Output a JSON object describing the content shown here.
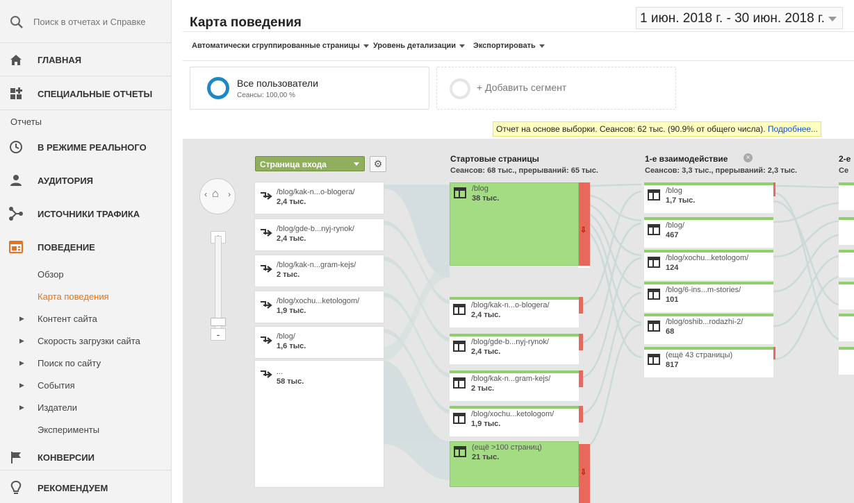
{
  "search": {
    "placeholder": "Поиск в отчетах и Справке"
  },
  "nav": {
    "home": "ГЛАВНАЯ",
    "custom": "СПЕЦИАЛЬНЫЕ ОТЧЕТЫ",
    "reports_section": "Отчеты",
    "realtime": "В РЕЖИМЕ РЕАЛЬНОГО",
    "audience": "АУДИТОРИЯ",
    "acquisition": "ИСТОЧНИКИ ТРАФИКА",
    "behavior": "ПОВЕДЕНИЕ",
    "behavior_items": [
      "Обзор",
      "Карта поведения",
      "Контент сайта",
      "Скорость загрузки сайта",
      "Поиск по сайту",
      "События",
      "Издатели",
      "Эксперименты"
    ],
    "conversions": "КОНВЕРСИИ",
    "recommend": "РЕКОМЕНДУЕМ"
  },
  "header": {
    "title": "Карта поведения",
    "date_range": "1 июн. 2018 г. - 30 июн. 2018 г."
  },
  "toolbar": {
    "grouped": "Автоматически сгруппированные страницы",
    "detail": "Уровень детализации",
    "export": "Экспортировать"
  },
  "segments": {
    "all_users": "Все пользователи",
    "all_users_sub": "Сеансы: 100,00 %",
    "add": "+ Добавить сегмент"
  },
  "notice": {
    "text": "Отчет на основе выборки. Сеансов: 62 тыс. (90.9% от общего числа).",
    "link": "Подробнее..."
  },
  "flow": {
    "dimension": "Страница входа",
    "sources": [
      {
        "name": "/blog/kak-n...o-blogera/",
        "value": "2,4 тыс."
      },
      {
        "name": "/blog/gde-b...nyj-rynok/",
        "value": "2,4 тыс."
      },
      {
        "name": "/blog/kak-n...gram-kejs/",
        "value": "2 тыс."
      },
      {
        "name": "/blog/xochu...ketologom/",
        "value": "1,9 тыс."
      },
      {
        "name": "/blog/",
        "value": "1,6 тыс."
      },
      {
        "name": "...",
        "value": "58 тыс."
      }
    ],
    "start": {
      "title": "Стартовые страницы",
      "sub": "Сеансов: 68 тыс., прерываний: 65 тыс.",
      "nodes": [
        {
          "name": "/blog",
          "value": "38 тыс."
        },
        {
          "name": "/blog/kak-n...o-blogera/",
          "value": "2,4 тыс."
        },
        {
          "name": "/blog/gde-b...nyj-rynok/",
          "value": "2,4 тыс."
        },
        {
          "name": "/blog/kak-n...gram-kejs/",
          "value": "2 тыс."
        },
        {
          "name": "/blog/xochu...ketologom/",
          "value": "1,9 тыс."
        },
        {
          "name": "(ещё >100 страниц)",
          "value": "21 тыс."
        }
      ]
    },
    "step1": {
      "title": "1-е взаимодействие",
      "sub": "Сеансов: 3,3 тыс., прерываний: 2,3 тыс.",
      "nodes": [
        {
          "name": "/blog",
          "value": "1,7 тыс."
        },
        {
          "name": "/blog/",
          "value": "467"
        },
        {
          "name": "/blog/xochu...ketologom/",
          "value": "124"
        },
        {
          "name": "/blog/6-ins...m-stories/",
          "value": "101"
        },
        {
          "name": "/blog/oshib...rodazhi-2/",
          "value": "68"
        },
        {
          "name": "(ещё 43 страницы)",
          "value": "817"
        }
      ]
    },
    "step2": {
      "title": "2-е",
      "sub": "Се"
    }
  },
  "colors": {
    "accent": "#e8711a",
    "green": "#a4dc84",
    "drop": "#e8685b",
    "ring": "#1e88c7"
  }
}
